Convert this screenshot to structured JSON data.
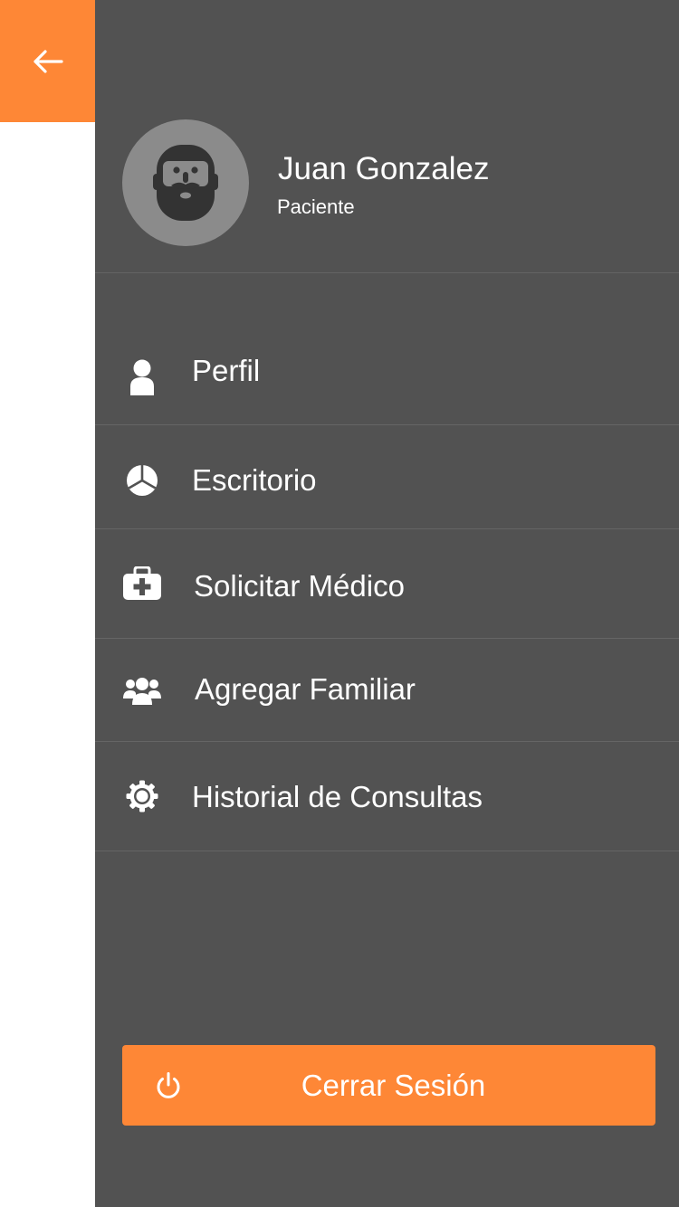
{
  "colors": {
    "accent": "#fe8736",
    "drawer_background": "#525252",
    "avatar_background": "#8b8b8b",
    "text": "#ffffff"
  },
  "back": {
    "icon": "arrow-left-icon"
  },
  "profile": {
    "name": "Juan Gonzalez",
    "role": "Paciente",
    "avatar_icon": "bearded-man-avatar"
  },
  "menu": {
    "items": [
      {
        "label": "Perfil",
        "icon": "person-icon"
      },
      {
        "label": "Escritorio",
        "icon": "pie-chart-icon"
      },
      {
        "label": "Solicitar Médico",
        "icon": "medical-kit-icon"
      },
      {
        "label": "Agregar Familiar",
        "icon": "users-group-icon"
      },
      {
        "label": "Historial de Consultas",
        "icon": "gear-icon"
      }
    ]
  },
  "logout": {
    "label": "Cerrar Sesión",
    "icon": "power-icon"
  }
}
